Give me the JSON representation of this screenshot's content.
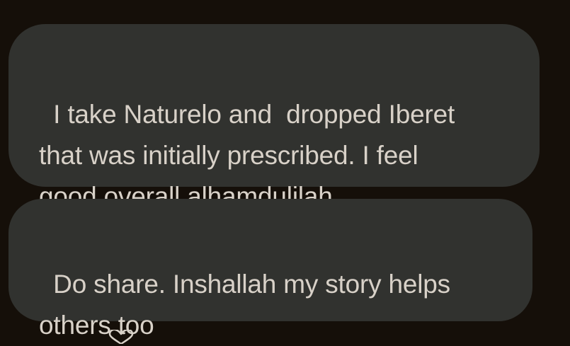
{
  "messages": [
    {
      "text": "I take Naturelo and  dropped Iberet\nthat was initially prescribed. I feel\ngood overall alhamdulilah."
    },
    {
      "text": "Do share. Inshallah my story helps\nothers too"
    }
  ],
  "reaction": {
    "icon": "heart-icon"
  },
  "colors": {
    "background": "#150f09",
    "bubble": "#31322f",
    "text": "#d8d1c8"
  }
}
